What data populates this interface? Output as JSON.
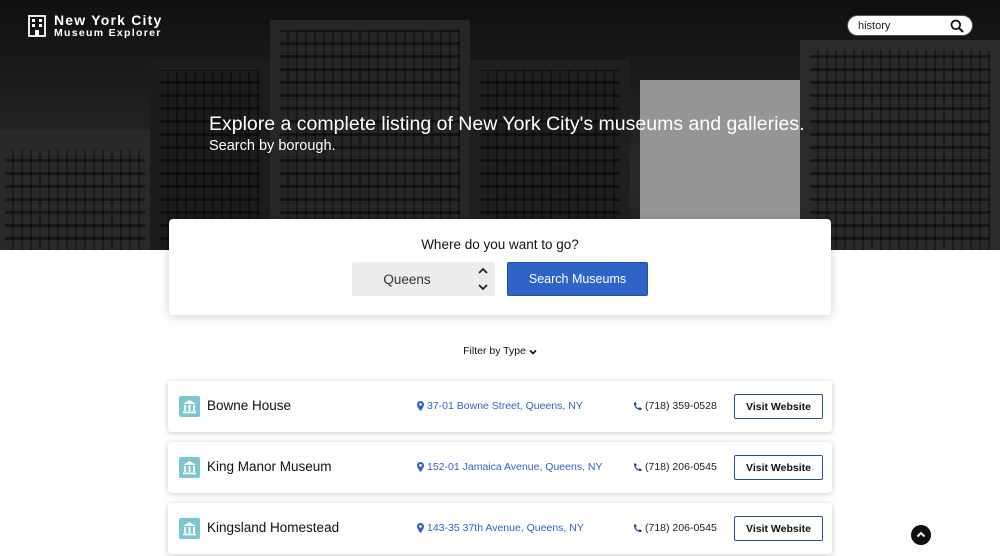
{
  "header": {
    "brand_line1": "New York City",
    "brand_line2": "Museum Explorer",
    "search_value": "history"
  },
  "hero": {
    "headline": "Explore a complete listing of New York City's museums and galleries.",
    "subheadline": "Search by borough."
  },
  "search_card": {
    "question": "Where do you want to go?",
    "borough_value": "Queens",
    "button_label": "Search Museums"
  },
  "filter": {
    "label": "Filter by Type"
  },
  "museums": [
    {
      "name": "Bowne House",
      "address": "37-01 Bowne Street, Queens, NY",
      "phone": "(718) 359-0528",
      "action": "Visit Website"
    },
    {
      "name": "King Manor Museum",
      "address": "152-01 Jamaica Avenue, Queens, NY",
      "phone": "(718) 206-0545",
      "action": "Visit Website"
    },
    {
      "name": "Kingsland Homestead",
      "address": "143-35 37th Avenue, Queens, NY",
      "phone": "(718) 206-0545",
      "action": "Visit Website"
    }
  ],
  "colors": {
    "accent": "#2f63c7",
    "badge": "#7cc6cf"
  }
}
